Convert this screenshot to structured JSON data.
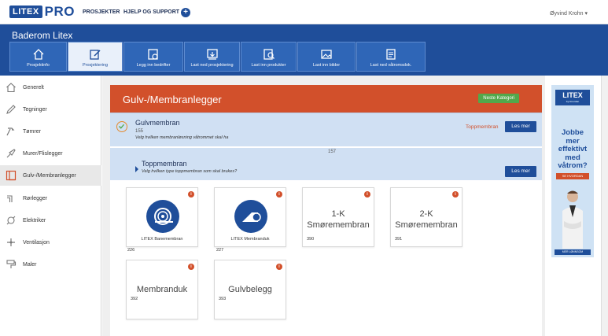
{
  "topbar": {
    "logo_text": "LITEX",
    "logo_pro": "PRO",
    "nav": [
      "PROSJEKTER",
      "HJELP OG SUPPORT"
    ],
    "add_icon": "plus-circle-icon",
    "user_name": "Øyvind Krohn",
    "user_caret": "▾"
  },
  "header": {
    "project_title": "Baderom Litex",
    "steps": [
      {
        "label": "Prosjektinfo",
        "icon": "home-icon",
        "active": false
      },
      {
        "label": "Prosjektering",
        "icon": "edit-icon",
        "active": true
      },
      {
        "label": "Legg inn bedrifter",
        "icon": "company-icon",
        "active": false
      },
      {
        "label": "Last ned prosjektering",
        "icon": "download-icon",
        "active": false
      },
      {
        "label": "Last inn produkter",
        "icon": "products-icon",
        "active": false
      },
      {
        "label": "Last inn bilder",
        "icon": "images-icon",
        "active": false
      },
      {
        "label": "Last ned våtromsdok.",
        "icon": "document-icon",
        "active": false
      }
    ]
  },
  "sidebar": {
    "items": [
      {
        "label": "Generelt",
        "icon": "house-icon"
      },
      {
        "label": "Tegninger",
        "icon": "pencil-icon"
      },
      {
        "label": "Tømrer",
        "icon": "hammer-icon"
      },
      {
        "label": "Murer/Flislegger",
        "icon": "trowel-icon"
      },
      {
        "label": "Gulv-/Membranlegger",
        "icon": "floor-icon",
        "active": true
      },
      {
        "label": "Rørlegger",
        "icon": "pipe-icon"
      },
      {
        "label": "Elektriker",
        "icon": "plug-icon"
      },
      {
        "label": "Ventilasjon",
        "icon": "fan-icon"
      },
      {
        "label": "Maler",
        "icon": "roller-icon"
      }
    ]
  },
  "category": {
    "title": "Gulv-/Membranlegger",
    "next_button": "Neste Kategori"
  },
  "rows": [
    {
      "title": "Gulvmembran",
      "id": "155",
      "subtitle": "Velg hvilken membranløsning våtrommet skal ha",
      "selected_tag": "Toppmembran",
      "button": "Les mer"
    },
    {
      "title": "Toppmembran",
      "id": "157",
      "subtitle": "Velg hvilken type toppmembran som skal brukes?",
      "button": "Les mer"
    }
  ],
  "cards": [
    {
      "label": "LITEX Banemembran",
      "id": "226",
      "type": "image",
      "icon": "roll-icon"
    },
    {
      "label": "LITEX Membranduk",
      "id": "227",
      "type": "image",
      "icon": "fabric-roll-icon"
    },
    {
      "label": "1-K Smøremembran",
      "line1": "1-K",
      "line2": "Smøremembran",
      "id": "390",
      "type": "text"
    },
    {
      "label": "2-K Smøremembran",
      "line1": "2-K",
      "line2": "Smøremembran",
      "id": "391",
      "type": "text"
    },
    {
      "label": "Membranduk",
      "id": "392",
      "type": "text-one"
    },
    {
      "label": "Gulvbelegg",
      "id": "393",
      "type": "text-one"
    }
  ],
  "ad": {
    "logo": "LITEX",
    "logo_sub": "by Hvordan",
    "text_lines": [
      "Jobbe mer",
      "effektivt",
      "med",
      "våtrom?"
    ],
    "button": "SE HVORDAN",
    "footer": "MER LØNNSOM"
  },
  "colors": {
    "brand_blue": "#1f4e9a",
    "accent_orange": "#d2502b",
    "green": "#52a84b",
    "light_blue": "#d0e0f3"
  }
}
